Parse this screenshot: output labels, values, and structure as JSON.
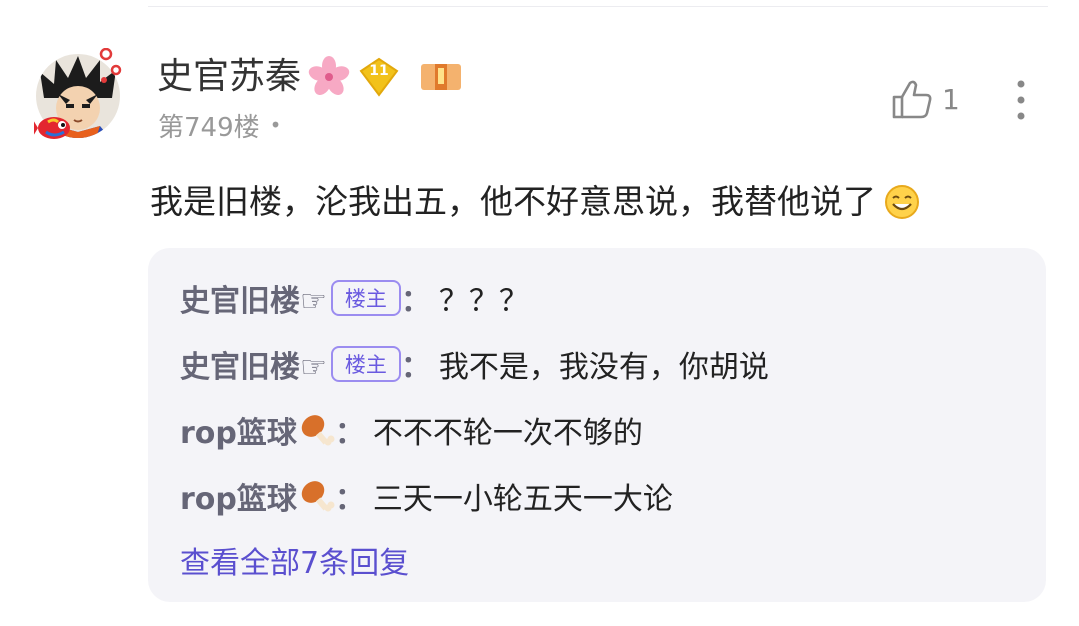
{
  "comment": {
    "username": "史官苏秦",
    "level": "11",
    "floor": "第749楼",
    "floor_dot": "•",
    "like_count": "1",
    "content": "我是旧楼，沦我出五，他不好意思说，我替他说了"
  },
  "replies": [
    {
      "user": "史官旧楼☞",
      "badge": "楼主",
      "colon": "：",
      "text": "？？？"
    },
    {
      "user": "史官旧楼☞",
      "badge": "楼主",
      "colon": "：",
      "text": "我不是，我没有，你胡说"
    },
    {
      "user": "rop篮球",
      "badge": "",
      "colon": "：",
      "text": "不不不轮一次不够的"
    },
    {
      "user": "rop篮球",
      "badge": "",
      "colon": "：",
      "text": "三天一小轮五天一大论"
    }
  ],
  "view_all_label": "查看全部7条回复",
  "colors": {
    "accent": "#5a4fcf",
    "badge_border": "#9b8cf0",
    "reply_bg": "#f4f4f8",
    "level_gold": "#f2c21a"
  },
  "icons": [
    "flower-icon",
    "level-badge-icon",
    "medal-icon",
    "thumbs-up-icon",
    "more-vertical-icon",
    "smile-emoji-icon",
    "drumstick-icon"
  ]
}
